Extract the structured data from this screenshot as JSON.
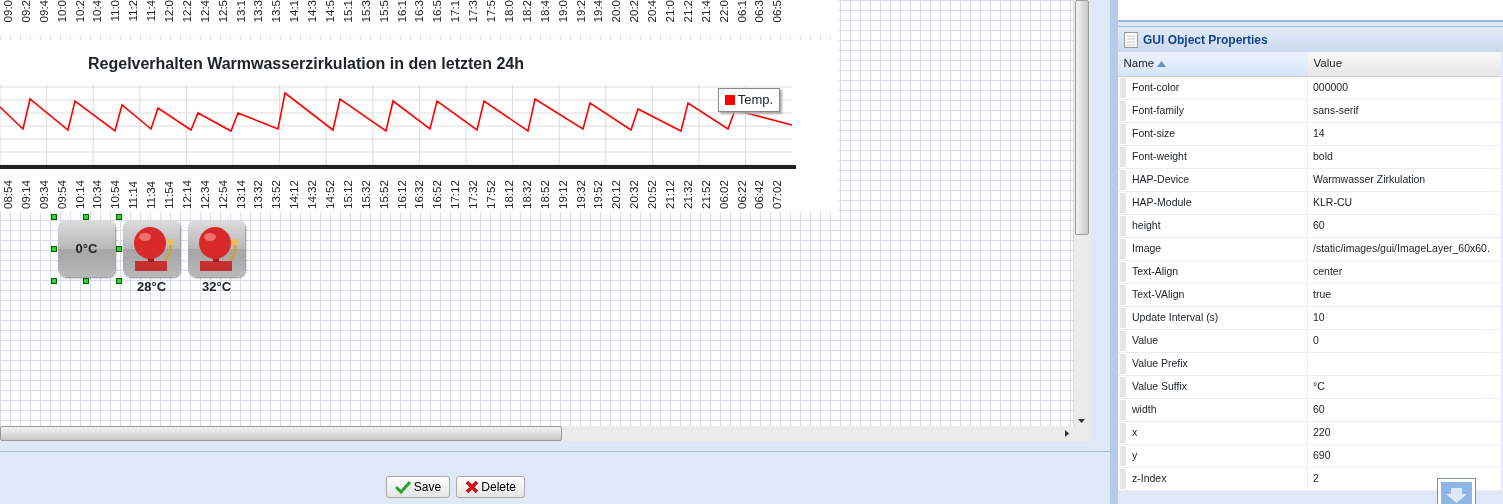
{
  "upper_chart": {
    "x_labels": [
      "09:0",
      "09:2",
      "09:4",
      "10:0",
      "10:2",
      "10:4",
      "11:0",
      "11:2",
      "11:4",
      "12:0",
      "12:2",
      "12:4",
      "12:5",
      "13:1",
      "13:3",
      "13:5",
      "14:1",
      "14:3",
      "14:5",
      "15:1",
      "15:3",
      "15:5",
      "16:1",
      "16:3",
      "16:5",
      "17:1",
      "17:3",
      "17:5",
      "18:0",
      "18:2",
      "18:4",
      "19:0",
      "19:2",
      "19:4",
      "20:0",
      "20:2",
      "20:4",
      "21:0",
      "21:2",
      "21:4",
      "22:0",
      "06:1",
      "06:3",
      "06:5"
    ]
  },
  "chart": {
    "title": "Regelverhalten Warmwasserzirkulation in den letzten 24h",
    "legend": {
      "label": "Temp.",
      "color": "#ff0000"
    },
    "x_labels": [
      "08:54",
      "09:14",
      "09:34",
      "09:54",
      "10:14",
      "10:34",
      "10:54",
      "11:14",
      "11:34",
      "11:54",
      "12:14",
      "12:34",
      "12:54",
      "13:14",
      "13:32",
      "13:52",
      "14:12",
      "14:32",
      "14:52",
      "15:12",
      "15:32",
      "15:52",
      "16:12",
      "16:32",
      "16:52",
      "17:12",
      "17:32",
      "17:52",
      "18:12",
      "18:32",
      "18:52",
      "19:12",
      "19:32",
      "19:52",
      "20:12",
      "20:32",
      "20:52",
      "21:12",
      "21:32",
      "21:52",
      "06:02",
      "06:22",
      "06:42",
      "07:02"
    ]
  },
  "widgets": [
    {
      "kind": "value",
      "label": "0°C",
      "selected": true
    },
    {
      "kind": "bell",
      "label": "28°C",
      "selected": false
    },
    {
      "kind": "bell",
      "label": "32°C",
      "selected": false
    }
  ],
  "buttons": [
    {
      "kind": "save",
      "label": "Save"
    },
    {
      "kind": "delete",
      "label": "Delete"
    }
  ],
  "properties": {
    "title": "GUI Object Properties",
    "columns": [
      {
        "label": "Name",
        "sorted": true
      },
      {
        "label": "Value",
        "sorted": false
      }
    ],
    "rows": [
      {
        "name": "Font-color",
        "value": "000000"
      },
      {
        "name": "Font-family",
        "value": "sans-serif"
      },
      {
        "name": "Font-size",
        "value": "14"
      },
      {
        "name": "Font-weight",
        "value": "bold"
      },
      {
        "name": "HAP-Device",
        "value": "Warmwasser Zirkulation"
      },
      {
        "name": "HAP-Module",
        "value": "KLR-CU"
      },
      {
        "name": "height",
        "value": "60"
      },
      {
        "name": "Image",
        "value": "/static/images/gui/ImageLayer_60x60."
      },
      {
        "name": "Text-Align",
        "value": "center"
      },
      {
        "name": "Text-VAlign",
        "value": "true"
      },
      {
        "name": "Update Interval (s)",
        "value": "10"
      },
      {
        "name": "Value",
        "value": "0"
      },
      {
        "name": "Value Prefix"
      },
      {
        "name": "Value Suffix",
        "value": "°C"
      },
      {
        "name": "width",
        "value": "60"
      },
      {
        "name": "x",
        "value": "220"
      },
      {
        "name": "y",
        "value": "690"
      },
      {
        "name": "z-Index",
        "value": "2"
      }
    ]
  }
}
